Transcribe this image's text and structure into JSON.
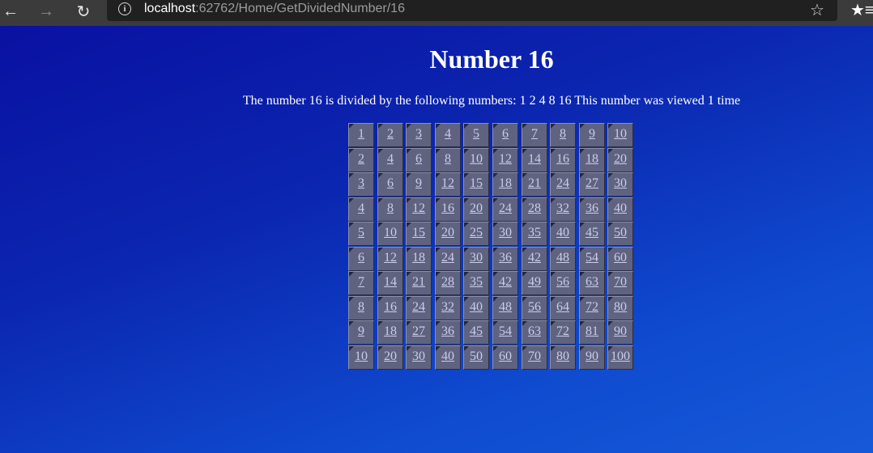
{
  "browser": {
    "url_host": "localhost",
    "url_rest": ":62762/Home/GetDividedNumber/16",
    "icons": {
      "back": "back-arrow-icon",
      "forward": "forward-arrow-icon",
      "reload": "reload-icon",
      "info": "info-icon",
      "favorite": "star-icon",
      "favorites_list": "favorites-icon"
    }
  },
  "page": {
    "title": "Number 16",
    "text": "The number 16 is divided by the following numbers: 1 2 4 8 16 This number was viewed 1 time"
  },
  "table": {
    "rows": [
      [
        "1",
        "2",
        "3",
        "4",
        "5",
        "6",
        "7",
        "8",
        "9",
        "10"
      ],
      [
        "2",
        "4",
        "6",
        "8",
        "10",
        "12",
        "14",
        "16",
        "18",
        "20"
      ],
      [
        "3",
        "6",
        "9",
        "12",
        "15",
        "18",
        "21",
        "24",
        "27",
        "30"
      ],
      [
        "4",
        "8",
        "12",
        "16",
        "20",
        "24",
        "28",
        "32",
        "36",
        "40"
      ],
      [
        "5",
        "10",
        "15",
        "20",
        "25",
        "30",
        "35",
        "40",
        "45",
        "50"
      ],
      [
        "6",
        "12",
        "18",
        "24",
        "30",
        "36",
        "42",
        "48",
        "54",
        "60"
      ],
      [
        "7",
        "14",
        "21",
        "28",
        "35",
        "42",
        "49",
        "56",
        "63",
        "70"
      ],
      [
        "8",
        "16",
        "24",
        "32",
        "40",
        "48",
        "56",
        "64",
        "72",
        "80"
      ],
      [
        "9",
        "18",
        "27",
        "36",
        "45",
        "54",
        "63",
        "72",
        "81",
        "90"
      ],
      [
        "10",
        "20",
        "30",
        "40",
        "50",
        "60",
        "70",
        "80",
        "90",
        "100"
      ]
    ]
  },
  "colors": {
    "background_start": "#0a0fa0",
    "background_end": "#1659d8",
    "cell_fill": "#5f6380",
    "link": "#c9cde8"
  }
}
